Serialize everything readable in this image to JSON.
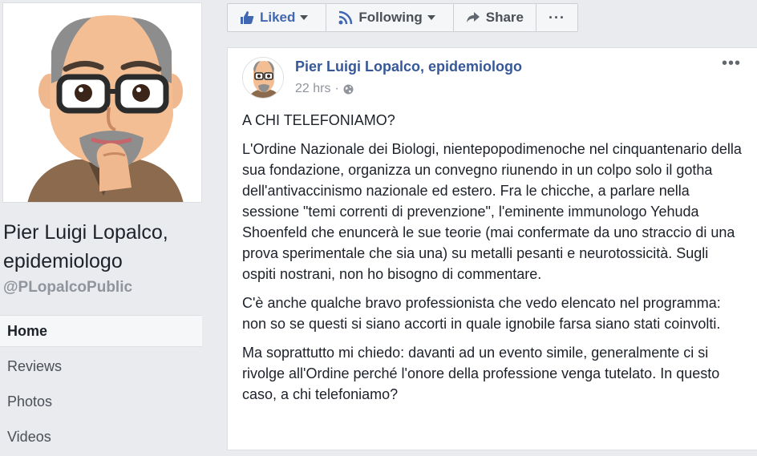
{
  "page": {
    "name": "Pier Luigi Lopalco, epidemiologo",
    "handle": "@PLopalcoPublic"
  },
  "nav": [
    {
      "label": "Home",
      "active": true
    },
    {
      "label": "Reviews",
      "active": false
    },
    {
      "label": "Photos",
      "active": false
    },
    {
      "label": "Videos",
      "active": false
    }
  ],
  "actions": {
    "liked": "Liked",
    "following": "Following",
    "share": "Share",
    "more": "···"
  },
  "post": {
    "author": "Pier Luigi Lopalco, epidemiologo",
    "time": "22 hrs",
    "separator": "·",
    "more": "•••",
    "paragraphs": [
      "A CHI TELEFONIAMO?",
      "L'Ordine Nazionale dei Biologi, nientepopodimenoche nel cinquantenario della sua fondazione, organizza un convegno riunendo in un colpo solo il gotha dell'antivaccinismo nazionale ed estero. Fra le chicche, a parlare nella sessione \"temi correnti di prevenzione\", l'eminente immunologo Yehuda Shoenfeld che enuncerà le sue teorie (mai confermate da uno straccio di una prova sperimentale che sia una) su metalli pesanti e neurotossicità. Sugli ospiti nostrani, non ho bisogno di commentare.",
      "C'è anche qualche bravo professionista che vedo elencato nel programma: non so se questi si siano accorti in quale ignobile farsa siano stati coinvolti.",
      "Ma soprattutto mi chiedo: davanti ad un evento simile, generalmente ci si rivolge all'Ordine perché l'onore della professione venga tutelato. In questo caso, a chi telefoniamo?"
    ]
  },
  "icons": {
    "like": "thumbs-up-icon",
    "follow": "rss-icon",
    "share": "share-arrow-icon",
    "privacy": "globe-icon"
  },
  "colors": {
    "link": "#365899",
    "like_blue": "#4267b2",
    "background": "#e9ebee"
  }
}
